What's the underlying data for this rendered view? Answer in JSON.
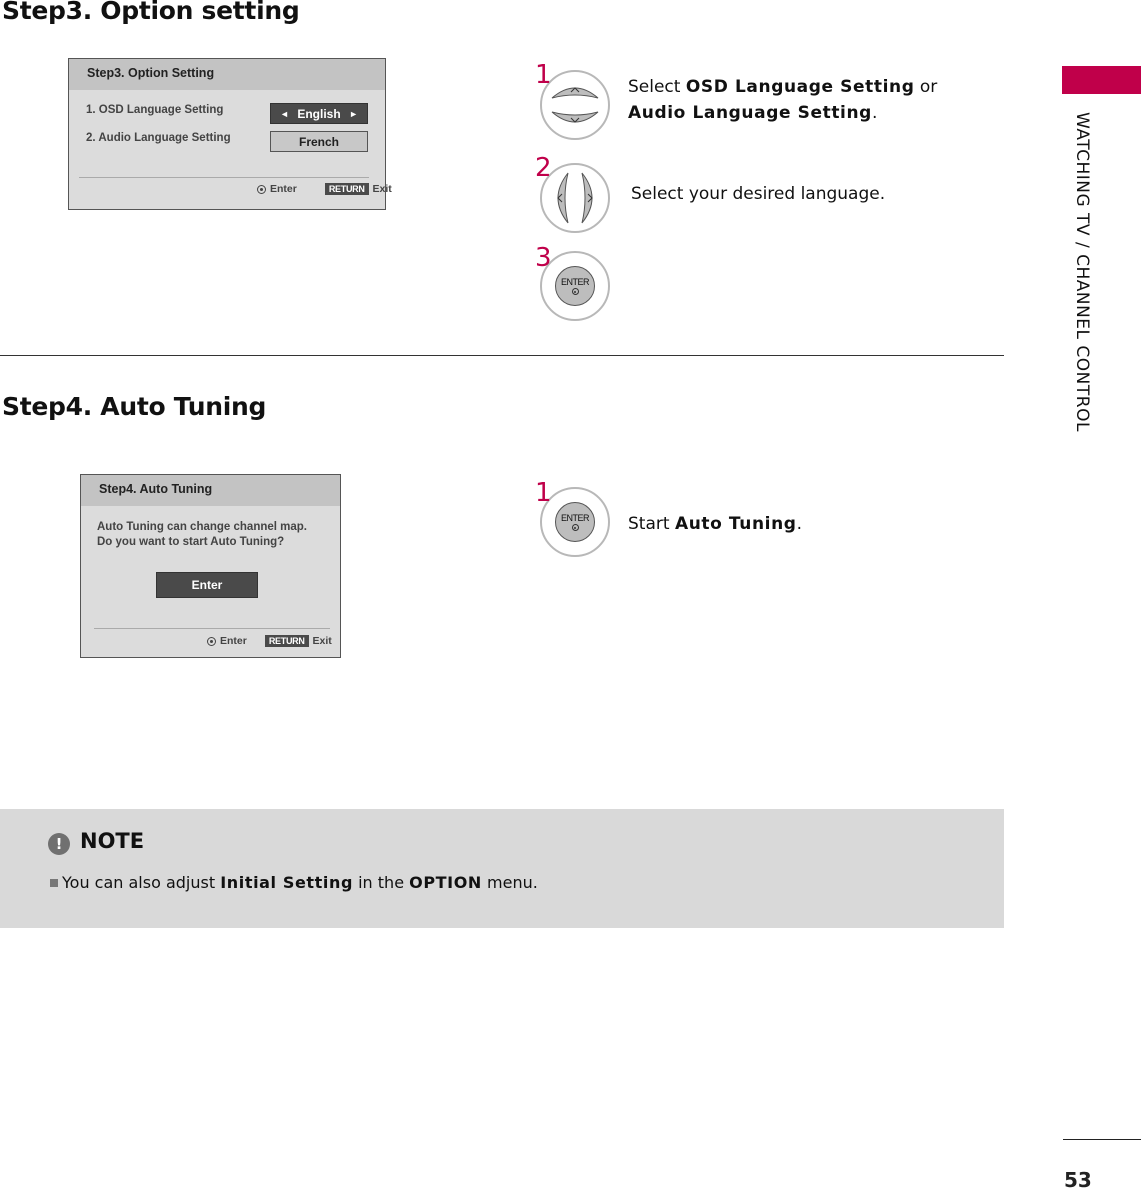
{
  "sidebar": {
    "section_title": "WATCHING TV / CHANNEL CONTROL",
    "accent_color": "#c0004a",
    "page_number": "53"
  },
  "step3": {
    "heading": "Step3. Option setting",
    "menu": {
      "title": "Step3. Option Setting",
      "rows": [
        {
          "label": "1. OSD Language Setting",
          "value": "English",
          "left_arrow": "◄",
          "right_arrow": "►",
          "active": true
        },
        {
          "label": "2. Audio Language Setting",
          "value": "French",
          "active": false
        }
      ],
      "footer": {
        "enter_label": "Enter",
        "return_label": "RETURN",
        "exit_label": "Exit"
      }
    },
    "instructions": [
      {
        "number": "1",
        "button": "up-down-buttons",
        "text_before": "Select ",
        "bold1": "OSD Language Setting",
        "text_mid": " or",
        "bold2": "Audio Language Setting",
        "text_after": "."
      },
      {
        "number": "2",
        "button": "left-right-buttons",
        "text": "Select your desired language."
      },
      {
        "number": "3",
        "button": "enter-button",
        "button_label": "ENTER"
      }
    ]
  },
  "step4": {
    "heading": "Step4. Auto Tuning",
    "menu": {
      "title": "Step4. Auto Tuning",
      "message_line1": "Auto Tuning can change channel map.",
      "message_line2": "Do you want to start Auto Tuning?",
      "button_label": "Enter",
      "footer": {
        "enter_label": "Enter",
        "return_label": "RETURN",
        "exit_label": "Exit"
      }
    },
    "instructions": [
      {
        "number": "1",
        "button": "enter-button",
        "button_label": "ENTER",
        "text_before": "Start ",
        "bold": "Auto Tuning",
        "text_after": "."
      }
    ]
  },
  "note": {
    "icon": "!",
    "title": "NOTE",
    "text_before": "You can also adjust ",
    "bold1": "Initial Setting",
    "text_mid": " in the ",
    "bold2": "OPTION",
    "text_after": " menu."
  }
}
